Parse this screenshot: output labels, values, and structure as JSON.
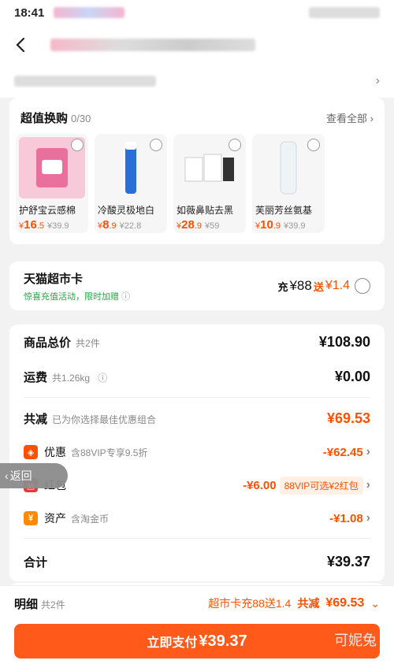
{
  "status_bar": {
    "time": "18:41"
  },
  "exchange": {
    "title": "超值换购",
    "count": "0/30",
    "view_all": "查看全部",
    "items": [
      {
        "name": "护舒宝云感棉",
        "price_symbol": "¥",
        "price_int": "16",
        "price_dec": ".5",
        "old_price": "¥39.9",
        "color": "#f8c9d9"
      },
      {
        "name": "冷酸灵极地白",
        "price_symbol": "¥",
        "price_int": "8",
        "price_dec": ".9",
        "old_price": "¥22.8",
        "color": "#cfe6fb"
      },
      {
        "name": "如薇鼻贴去黑",
        "price_symbol": "¥",
        "price_int": "28",
        "price_dec": ".9",
        "old_price": "¥59",
        "color": "#e7e7e7"
      },
      {
        "name": "芙丽芳丝氨基",
        "price_symbol": "¥",
        "price_int": "10",
        "price_dec": ".9",
        "old_price": "¥39.9",
        "color": "#eef3f6"
      }
    ]
  },
  "tmall_card": {
    "title": "天猫超市卡",
    "subtitle": "惊喜充值活动，限时加赠",
    "offer_prefix": "充",
    "offer_amount": "¥88",
    "offer_mid": "送",
    "offer_bonus": "¥1.4"
  },
  "summary": {
    "goods_label": "商品总价",
    "goods_count": "共2件",
    "goods_total": "¥108.90",
    "shipping_label": "运费",
    "shipping_weight": "共1.26kg",
    "shipping_fee": "¥0.00",
    "discount_label": "共减",
    "discount_note": "已为你选择最佳优惠组合",
    "discount_total": "¥69.53",
    "promo_label": "优惠",
    "promo_note": "含88VIP专享9.5折",
    "promo_value": "-¥62.45",
    "redpacket_label": "红包",
    "redpacket_value": "-¥6.00",
    "redpacket_tag": "88VIP可选¥2红包",
    "asset_label": "资产",
    "asset_note": "含淘金币",
    "asset_value": "-¥1.08",
    "total_label": "合计",
    "total_value": "¥39.37"
  },
  "return_button": {
    "label": "返回"
  },
  "bottom_bar": {
    "detail_label": "明细",
    "detail_count": "共2件",
    "detail_offer": "超市卡充88送1.4",
    "detail_save_label": "共减",
    "detail_save_value": "¥69.53",
    "pay_label": "立即支付",
    "pay_amount": "¥39.37"
  },
  "watermark": "可妮兔",
  "colors": {
    "accent": "#ff5000",
    "green": "#2aa548"
  }
}
